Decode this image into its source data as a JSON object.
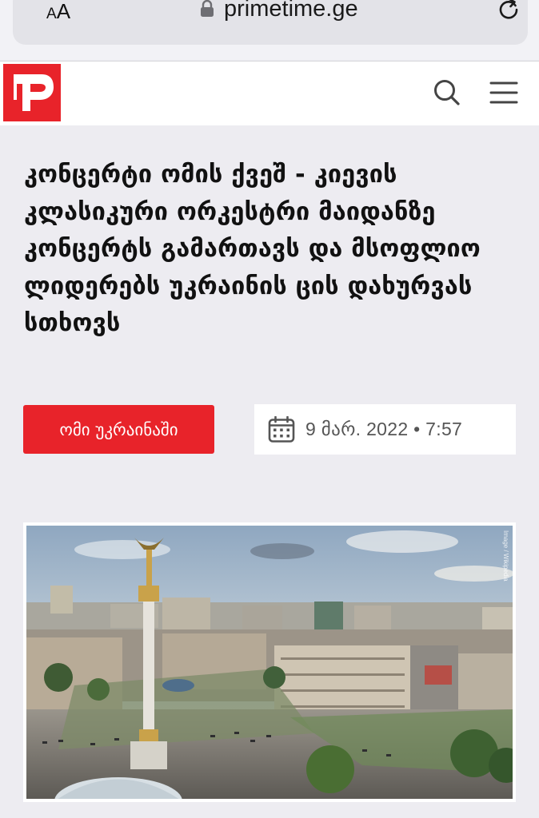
{
  "browser": {
    "text_size_label": "AA",
    "url": "primetime.ge"
  },
  "site": {
    "logo_icon": "primetime-logo-icon",
    "brand_color": "#e8232a"
  },
  "article": {
    "title": "კონცერტი ომის ქვეშ - კიევის კლასიკური ორკესტრი მაიდანზე კონცერტს გამართავს და მსოფლიო ლიდერებს უკრაინის ცის დახურვას სთხოვს",
    "category": "ომი უკრაინაში",
    "date": "9 მარ. 2022 • 7:57",
    "image_credit": "Image / Wikipedia"
  }
}
